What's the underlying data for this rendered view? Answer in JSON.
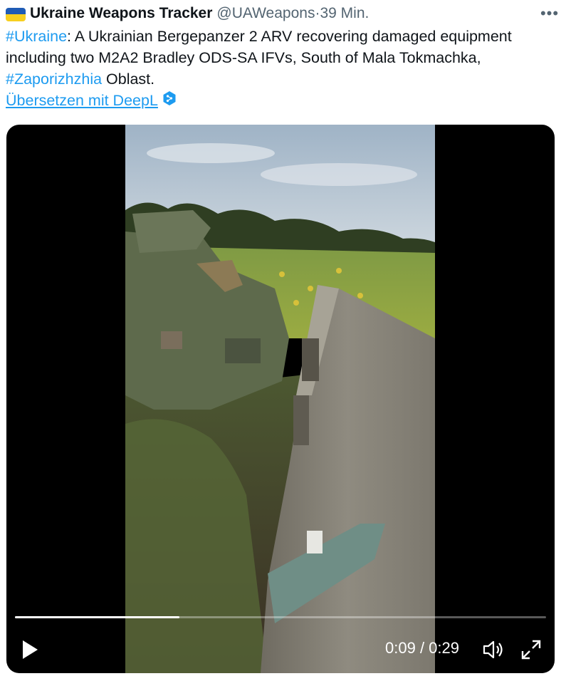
{
  "tweet": {
    "author_name": "Ukraine Weapons Tracker",
    "handle": "@UAWeapons",
    "separator": "·",
    "time_ago": "39 Min.",
    "more_label": "•••",
    "flag_colors": {
      "top": "#1f5bb5",
      "bottom": "#f7cf1f"
    },
    "text_parts": {
      "hashtag_1": "#Ukraine",
      "segment_1": ": A Ukrainian Bergepanzer 2 ARV recovering damaged equipment including two M2A2 Bradley ODS-SA IFVs, South of Mala Tokmachka, ",
      "hashtag_2": "#Zaporizhzhia",
      "segment_2": " Oblast."
    },
    "translate_link": "Übersetzen mit DeepL"
  },
  "video": {
    "current_time": "0:09",
    "time_separator": " / ",
    "duration": "0:29",
    "progress_fraction": 0.31,
    "icons": {
      "play": "play-icon",
      "volume": "volume-muted-icon",
      "fullscreen": "fullscreen-icon"
    }
  },
  "colors": {
    "accent": "#1d9bf0",
    "text": "#0f1419",
    "muted": "#536471",
    "video_bg": "#000000"
  }
}
